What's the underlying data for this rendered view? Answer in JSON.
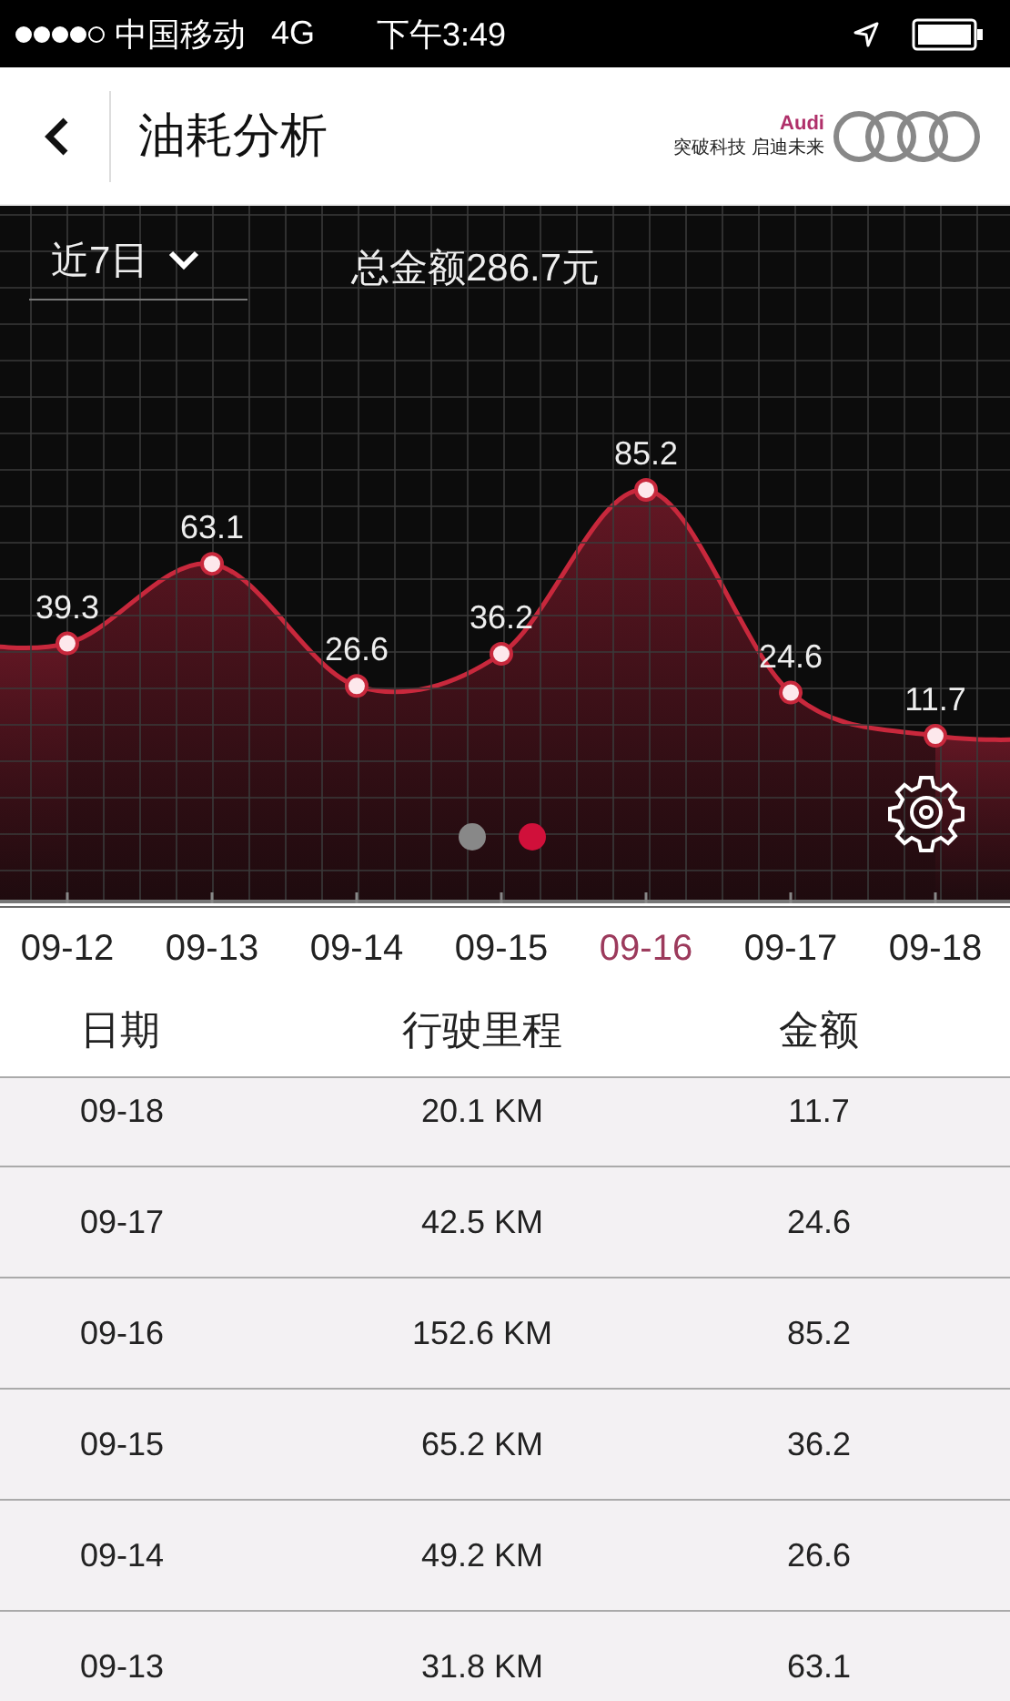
{
  "status_bar": {
    "carrier": "中国移动",
    "network": "4G",
    "time": "下午3:49"
  },
  "header": {
    "title": "油耗分析",
    "brand_name": "Audi",
    "slogan": "突破科技 启迪未来"
  },
  "chart_panel": {
    "period": "近7日",
    "total": "总金额286.7元",
    "chart_data": {
      "type": "area",
      "categories": [
        "09-12",
        "09-13",
        "09-14",
        "09-15",
        "09-16",
        "09-17",
        "09-18"
      ],
      "series": [
        {
          "color": "#c8283c",
          "values": [
            39.3,
            63.1,
            26.6,
            36.2,
            85.2,
            24.6,
            11.7
          ]
        }
      ],
      "data_labels": true,
      "grid": true
    },
    "category_selected": [
      false,
      false,
      false,
      false,
      true,
      false,
      false
    ],
    "pager": [
      {
        "selected": false
      },
      {
        "selected": true
      }
    ]
  },
  "table": {
    "columns": [
      "日期",
      "行驶里程",
      "金额"
    ],
    "rows": [
      {
        "date": "09-18",
        "distance": "20.1 KM",
        "amount": "11.7"
      },
      {
        "date": "09-17",
        "distance": "42.5 KM",
        "amount": "24.6"
      },
      {
        "date": "09-16",
        "distance": "152.6 KM",
        "amount": "85.2"
      },
      {
        "date": "09-15",
        "distance": "65.2 KM",
        "amount": "36.2"
      },
      {
        "date": "09-14",
        "distance": "49.2 KM",
        "amount": "26.6"
      },
      {
        "date": "09-13",
        "distance": "31.8 KM",
        "amount": "63.1"
      }
    ]
  }
}
